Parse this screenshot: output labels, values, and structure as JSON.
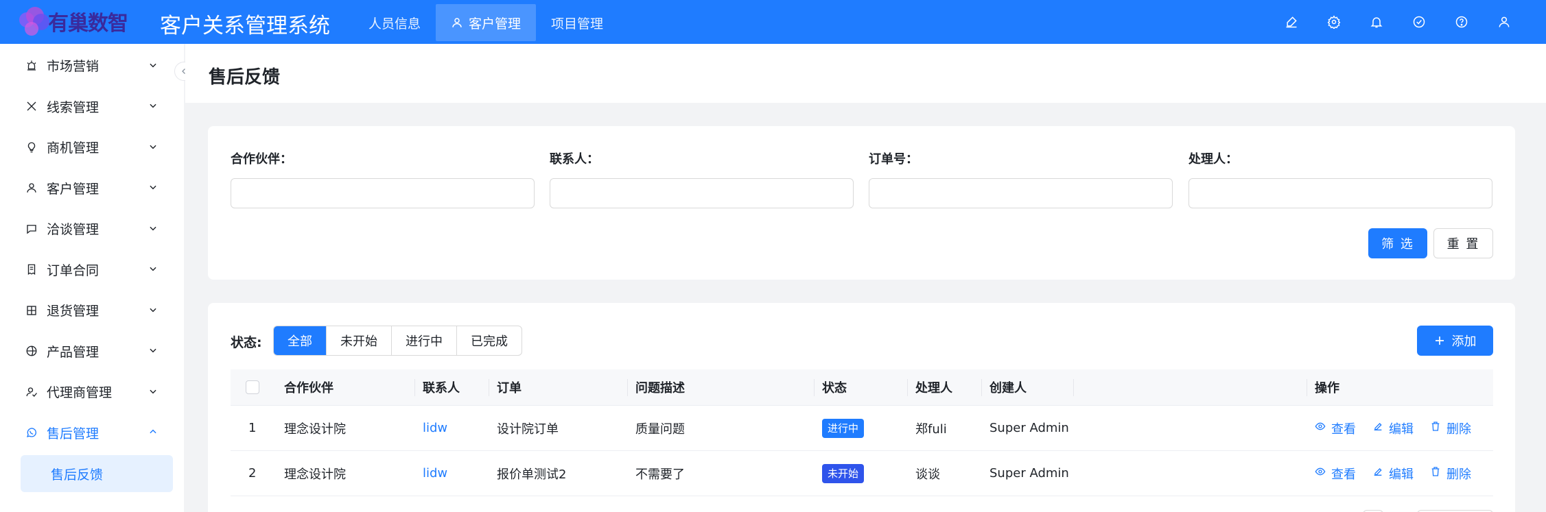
{
  "header": {
    "logo_text": "有巢数智",
    "app_title": "客户关系管理系统",
    "nav": [
      {
        "label": "人员信息",
        "active": false
      },
      {
        "label": "客户管理",
        "active": true,
        "icon": "user-icon"
      },
      {
        "label": "项目管理",
        "active": false
      }
    ],
    "icons": [
      "brush-icon",
      "gear-icon",
      "bell-icon",
      "check-circle-icon",
      "help-icon",
      "user-icon"
    ],
    "color": "#1f7cff"
  },
  "sidebar": {
    "items": [
      {
        "label": "市场营销",
        "icon": "alarm-icon"
      },
      {
        "label": "线索管理",
        "icon": "x-icon"
      },
      {
        "label": "商机管理",
        "icon": "bulb-icon"
      },
      {
        "label": "客户管理",
        "icon": "user-icon"
      },
      {
        "label": "洽谈管理",
        "icon": "chat-icon"
      },
      {
        "label": "订单合同",
        "icon": "receipt-icon"
      },
      {
        "label": "退货管理",
        "icon": "return-icon"
      },
      {
        "label": "产品管理",
        "icon": "product-icon"
      },
      {
        "label": "代理商管理",
        "icon": "agent-icon"
      },
      {
        "label": "售后管理",
        "icon": "whatsapp-icon",
        "open": true
      }
    ],
    "submenu": {
      "label": "售后反馈",
      "active": true
    }
  },
  "page": {
    "title": "售后反馈"
  },
  "filter": {
    "fields": [
      {
        "label": "合作伙伴：",
        "value": "",
        "placeholder": ""
      },
      {
        "label": "联系人：",
        "value": "",
        "placeholder": ""
      },
      {
        "label": "订单号：",
        "value": "",
        "placeholder": ""
      },
      {
        "label": "处理人：",
        "value": "",
        "placeholder": ""
      }
    ],
    "filter_button": "筛 选",
    "reset_button": "重 置"
  },
  "list": {
    "status_label": "状态:",
    "status_tabs": [
      {
        "label": "全部",
        "active": true
      },
      {
        "label": "未开始",
        "active": false
      },
      {
        "label": "进行中",
        "active": false
      },
      {
        "label": "已完成",
        "active": false
      }
    ],
    "add_button": "添加",
    "columns": [
      "合作伙伴",
      "联系人",
      "订单",
      "问题描述",
      "状态",
      "处理人",
      "创建人",
      "操作"
    ],
    "rows": [
      {
        "index": "1",
        "partner": "理念设计院",
        "contact": "lidw",
        "order": "设计院订单",
        "issue": "质量问题",
        "status": "进行中",
        "status_color": "#1f7cff",
        "handler": "郑fuli",
        "creator": "Super Admin"
      },
      {
        "index": "2",
        "partner": "理念设计院",
        "contact": "lidw",
        "order": "报价单测试2",
        "issue": "不需要了",
        "status": "未开始",
        "status_color": "#2f54eb",
        "handler": "谈谈",
        "creator": "Super Admin"
      }
    ],
    "actions": {
      "view": "查看",
      "edit": "编辑",
      "delete": "删除"
    }
  }
}
